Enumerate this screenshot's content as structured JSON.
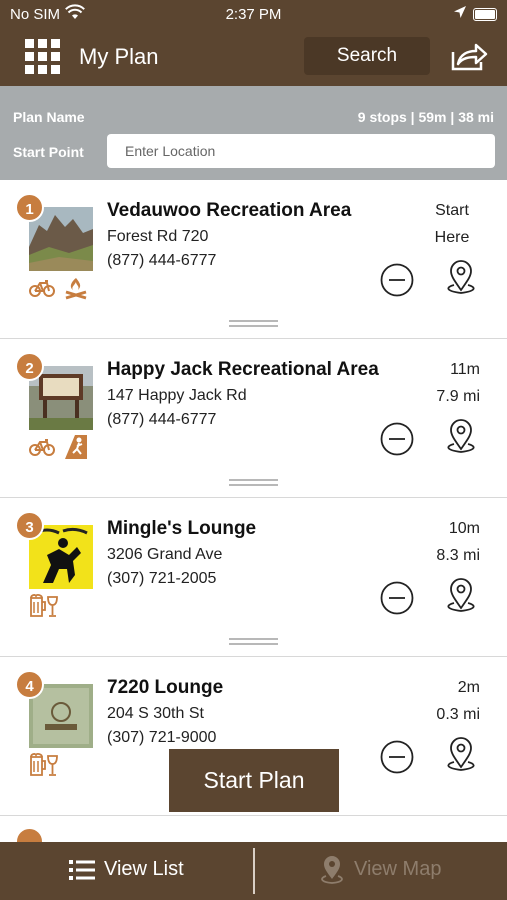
{
  "status_bar": {
    "carrier": "No SIM",
    "time": "2:37 PM"
  },
  "header": {
    "title": "My Plan",
    "search_label": "Search",
    "icons": [
      "grid-menu-icon",
      "share-icon"
    ]
  },
  "plan": {
    "name_label": "Plan Name",
    "summary": "9 stops | 59m | 38 mi",
    "start_point_label": "Start Point",
    "location_placeholder": "Enter Location"
  },
  "stops": [
    {
      "number": "1",
      "name": "Vedauwoo Recreation Area",
      "address": "Forest Rd 720",
      "phone": "(877) 444-6777",
      "meta_line1": "Start",
      "meta_line2": "Here",
      "amenities": [
        "bike-icon",
        "campfire-icon"
      ]
    },
    {
      "number": "2",
      "name": "Happy Jack Recreational Area",
      "address": "147 Happy Jack Rd",
      "phone": "(877) 444-6777",
      "meta_line1": "11m",
      "meta_line2": "7.9 mi",
      "amenities": [
        "bike-icon",
        "climbing-icon"
      ]
    },
    {
      "number": "3",
      "name": "Mingle's Lounge",
      "address": "3206 Grand Ave",
      "phone": "(307) 721-2005",
      "meta_line1": "10m",
      "meta_line2": "8.3 mi",
      "amenities": [
        "beer-wine-icon"
      ]
    },
    {
      "number": "4",
      "name": "7220 Lounge",
      "address": "204 S 30th St",
      "phone": "(307) 721-9000",
      "meta_line1": "2m",
      "meta_line2": "0.3 mi",
      "amenities": [
        "beer-wine-icon"
      ]
    }
  ],
  "actions": {
    "start_plan_label": "Start Plan"
  },
  "bottom_tabs": {
    "list_label": "View List",
    "map_label": "View Map"
  },
  "colors": {
    "brand_brown": "#5b4530",
    "accent_orange": "#c77d3f",
    "header_gray": "#a7abad"
  }
}
